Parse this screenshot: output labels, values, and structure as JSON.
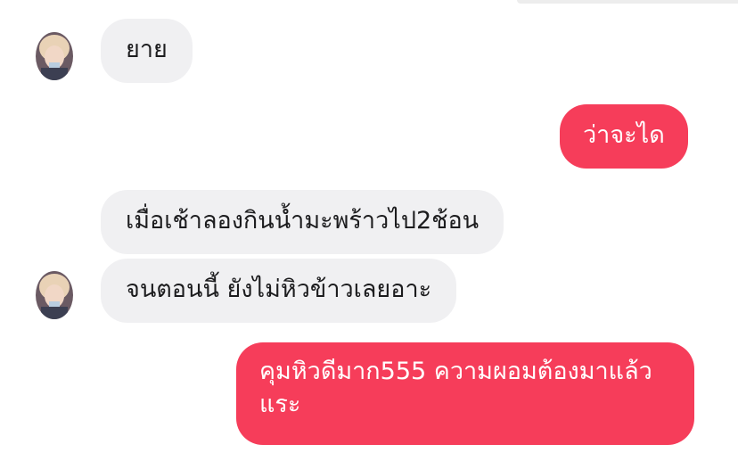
{
  "messages": [
    {
      "direction": "incoming",
      "text": "ยาย",
      "avatar": "user-avatar"
    },
    {
      "direction": "outgoing",
      "text": "ว่าจะได"
    },
    {
      "direction": "incoming",
      "text": "เมื่อเช้าลองกินน้ำมะพร้าวไป2ช้อน"
    },
    {
      "direction": "incoming",
      "text": "จนตอนนี้ ยังไม่หิวข้าวเลยอาะ",
      "avatar": "user-avatar"
    },
    {
      "direction": "outgoing",
      "text": "คุมหิวดีมาก555 ความผอมต้องมาแล้วแระ"
    }
  ],
  "colors": {
    "incoming_bubble": "#f0f0f2",
    "outgoing_bubble": "#f63d5a",
    "incoming_text": "#1c1c1e",
    "outgoing_text": "#ffffff"
  }
}
